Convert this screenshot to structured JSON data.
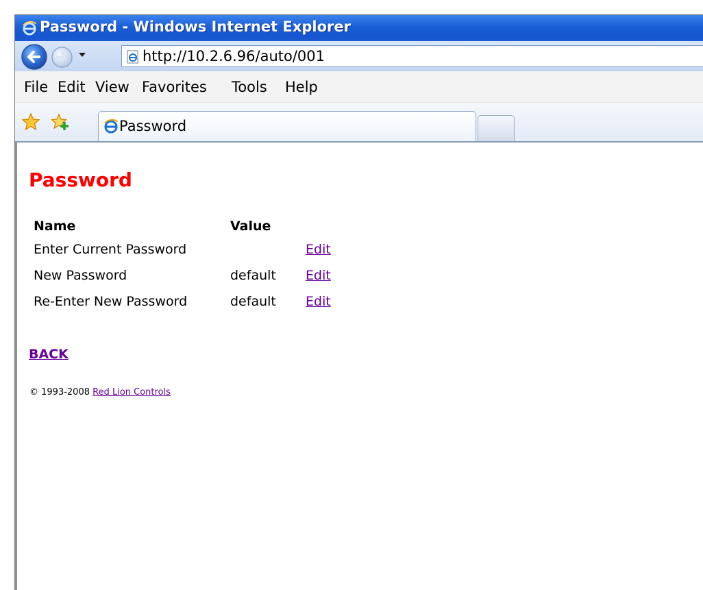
{
  "window": {
    "title": "Password - Windows Internet Explorer"
  },
  "address_bar": {
    "url": "http://10.2.6.96/auto/001"
  },
  "menu": {
    "items": [
      "File",
      "Edit",
      "View",
      "Favorites",
      "Tools",
      "Help"
    ]
  },
  "tabs": {
    "active_label": "Password"
  },
  "page": {
    "title": "Password",
    "table": {
      "headers": [
        "Name",
        "Value"
      ],
      "rows": [
        {
          "name": "Enter Current Password",
          "value": "",
          "action": "Edit"
        },
        {
          "name": "New Password",
          "value": "default",
          "action": "Edit"
        },
        {
          "name": "Re-Enter New Password",
          "value": "default",
          "action": "Edit"
        }
      ]
    },
    "back_label": "BACK",
    "footer": {
      "copyright": "© 1993-2008",
      "company_link": "Red Lion Controls"
    }
  },
  "colors": {
    "title_red": "#ff0000",
    "link_visited": "#660099",
    "titlebar_blue": "#1b5fd6"
  },
  "icons": {
    "title": "ie-logo-icon",
    "back": "back-arrow-icon",
    "forward": "forward-arrow-icon",
    "dropdown": "chevron-down-icon",
    "page": "ie-page-icon",
    "favorites": "favorites-star-icon",
    "add_favorite": "add-favorite-icon",
    "tab": "ie-logo-icon"
  }
}
